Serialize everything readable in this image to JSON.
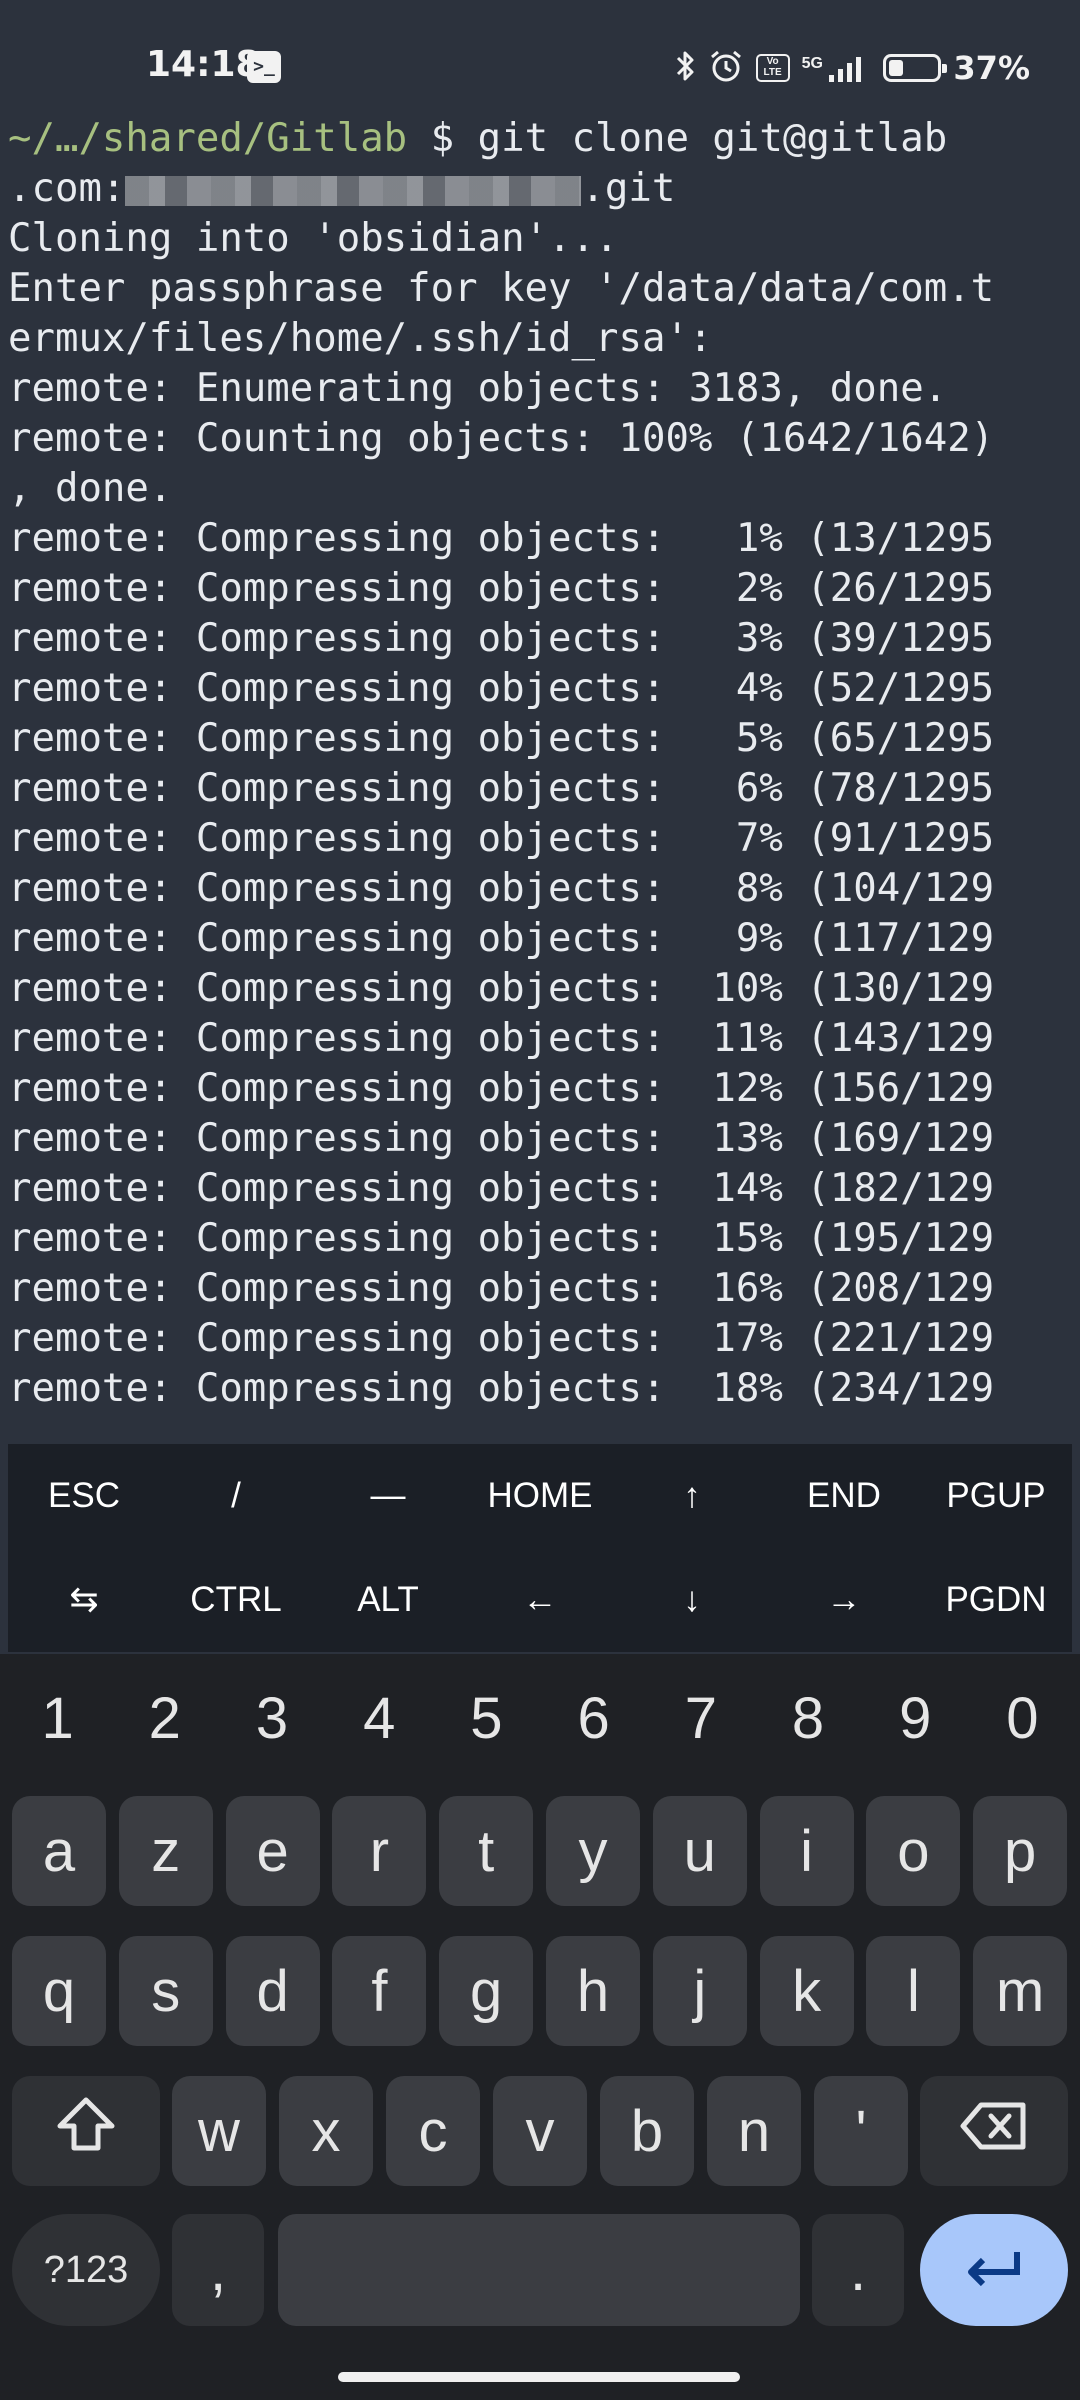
{
  "status_bar": {
    "time": "14:18",
    "network": "5G",
    "volte": "Vo LTE",
    "battery": "37%",
    "battery_level": 0.37
  },
  "terminal": {
    "lines": [
      {
        "type": "prompt",
        "path": "~/…/shared/Gitlab",
        "rest": " $ git clone git@gitlab"
      },
      {
        "type": "redacted",
        "before": ".com:",
        "after": ".git"
      },
      {
        "type": "text",
        "text": "Cloning into 'obsidian'..."
      },
      {
        "type": "text",
        "text": "Enter passphrase for key '/data/data/com.t"
      },
      {
        "type": "text",
        "text": "ermux/files/home/.ssh/id_rsa':"
      },
      {
        "type": "text",
        "text": "remote: Enumerating objects: 3183, done."
      },
      {
        "type": "text",
        "text": "remote: Counting objects: 100% (1642/1642)"
      },
      {
        "type": "text",
        "text": ", done."
      },
      {
        "type": "text",
        "text": "remote: Compressing objects:   1% (13/1295"
      },
      {
        "type": "text",
        "text": "remote: Compressing objects:   2% (26/1295"
      },
      {
        "type": "text",
        "text": "remote: Compressing objects:   3% (39/1295"
      },
      {
        "type": "text",
        "text": "remote: Compressing objects:   4% (52/1295"
      },
      {
        "type": "text",
        "text": "remote: Compressing objects:   5% (65/1295"
      },
      {
        "type": "text",
        "text": "remote: Compressing objects:   6% (78/1295"
      },
      {
        "type": "text",
        "text": "remote: Compressing objects:   7% (91/1295"
      },
      {
        "type": "text",
        "text": "remote: Compressing objects:   8% (104/129"
      },
      {
        "type": "text",
        "text": "remote: Compressing objects:   9% (117/129"
      },
      {
        "type": "text",
        "text": "remote: Compressing objects:  10% (130/129"
      },
      {
        "type": "text",
        "text": "remote: Compressing objects:  11% (143/129"
      },
      {
        "type": "text",
        "text": "remote: Compressing objects:  12% (156/129"
      },
      {
        "type": "text",
        "text": "remote: Compressing objects:  13% (169/129"
      },
      {
        "type": "text",
        "text": "remote: Compressing objects:  14% (182/129"
      },
      {
        "type": "text",
        "text": "remote: Compressing objects:  15% (195/129"
      },
      {
        "type": "text",
        "text": "remote: Compressing objects:  16% (208/129"
      },
      {
        "type": "text",
        "text": "remote: Compressing objects:  17% (221/129"
      },
      {
        "type": "text",
        "text": "remote: Compressing objects:  18% (234/129"
      }
    ]
  },
  "extra_keys": {
    "row1": [
      "ESC",
      "/",
      "—",
      "HOME",
      "↑",
      "END",
      "PGUP"
    ],
    "row2": [
      "⇆",
      "CTRL",
      "ALT",
      "←",
      "↓",
      "→",
      "PGDN"
    ]
  },
  "keyboard": {
    "numbers": [
      "1",
      "2",
      "3",
      "4",
      "5",
      "6",
      "7",
      "8",
      "9",
      "0"
    ],
    "row1": [
      "a",
      "z",
      "e",
      "r",
      "t",
      "y",
      "u",
      "i",
      "o",
      "p"
    ],
    "row2": [
      "q",
      "s",
      "d",
      "f",
      "g",
      "h",
      "j",
      "k",
      "l",
      "m"
    ],
    "row3": [
      "w",
      "x",
      "c",
      "v",
      "b",
      "n",
      "'"
    ],
    "symbols_label": "?123",
    "comma": ",",
    "period": ".",
    "icons": {
      "shift": "shift-icon",
      "backspace": "backspace-icon",
      "enter": "enter-icon"
    },
    "enter_color": "#a8c7fa"
  }
}
